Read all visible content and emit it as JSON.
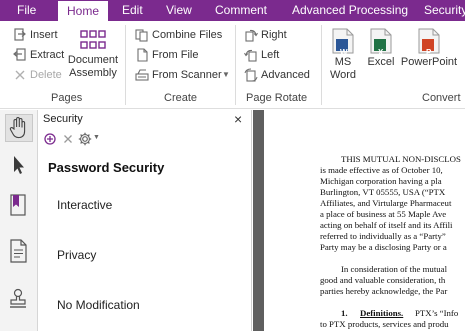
{
  "menu": {
    "tabs": [
      "File",
      "Home",
      "Edit",
      "View",
      "Comment",
      "Advanced Processing",
      "Security"
    ],
    "active": "Home"
  },
  "ribbon": {
    "pages_group": {
      "label": "Pages",
      "insert": "Insert",
      "extract": "Extract",
      "delete": "Delete",
      "document_assembly": [
        "Document",
        "Assembly"
      ]
    },
    "create_group": {
      "label": "Create",
      "combine_files": "Combine Files",
      "from_file": "From File",
      "from_scanner": "From Scanner"
    },
    "page_rotate_group": {
      "label": "Page Rotate",
      "right": "Right",
      "left": "Left",
      "advanced": "Advanced"
    },
    "convert_group": {
      "label": "Convert",
      "ms_word": [
        "MS",
        "Word"
      ],
      "excel": "Excel",
      "powerpoint": "PowerPoint",
      "word_icon_text": "W",
      "excel_icon_text": "X",
      "ppt_icon_text": "P"
    }
  },
  "panel": {
    "title": "Security",
    "heading": "Password Security",
    "items": [
      "Interactive",
      "Privacy",
      "No Modification"
    ]
  },
  "document": {
    "lines": [
      "THIS MUTUAL NON-DISCLOS",
      "is made effective as of October 10,",
      "Michigan corporation having a pla",
      "Burlington, VT 05555, USA (“PTX",
      "Affiliates, and Virtularge Pharmaceut",
      "a place of business at 55 Maple Ave",
      "acting on behalf of itself and its Affili",
      "referred to individually as a “Party”",
      "Party may be a disclosing Party or a",
      "In consideration of the mutual",
      "good and valuable consideration, th",
      "parties hereby acknowledge, the Par",
      "Definitions.",
      " PTX’s “Info",
      "to PTX products, services and produ"
    ],
    "definitions_number": "1."
  },
  "colors": {
    "brand": "#7b2a8e",
    "icon_gray": "#6e6e6e",
    "word_blue": "#2b5797",
    "excel_green": "#207245",
    "ppt_orange": "#d04526"
  },
  "icons": {
    "insert": "insert-pages-icon",
    "extract": "extract-pages-icon",
    "delete": "delete-x-icon",
    "assembly": "document-assembly-grid-icon",
    "combine": "combine-files-icon",
    "from_file": "from-file-icon",
    "from_scanner": "scanner-icon",
    "rotate_right": "rotate-right-icon",
    "rotate_left": "rotate-left-icon",
    "advanced": "advanced-rotate-icon",
    "hand": "hand-tool-icon",
    "select": "cursor-arrow-icon",
    "bookmark": "bookmark-icon",
    "pages": "page-thumbnail-icon",
    "stamp": "stamp-icon"
  }
}
